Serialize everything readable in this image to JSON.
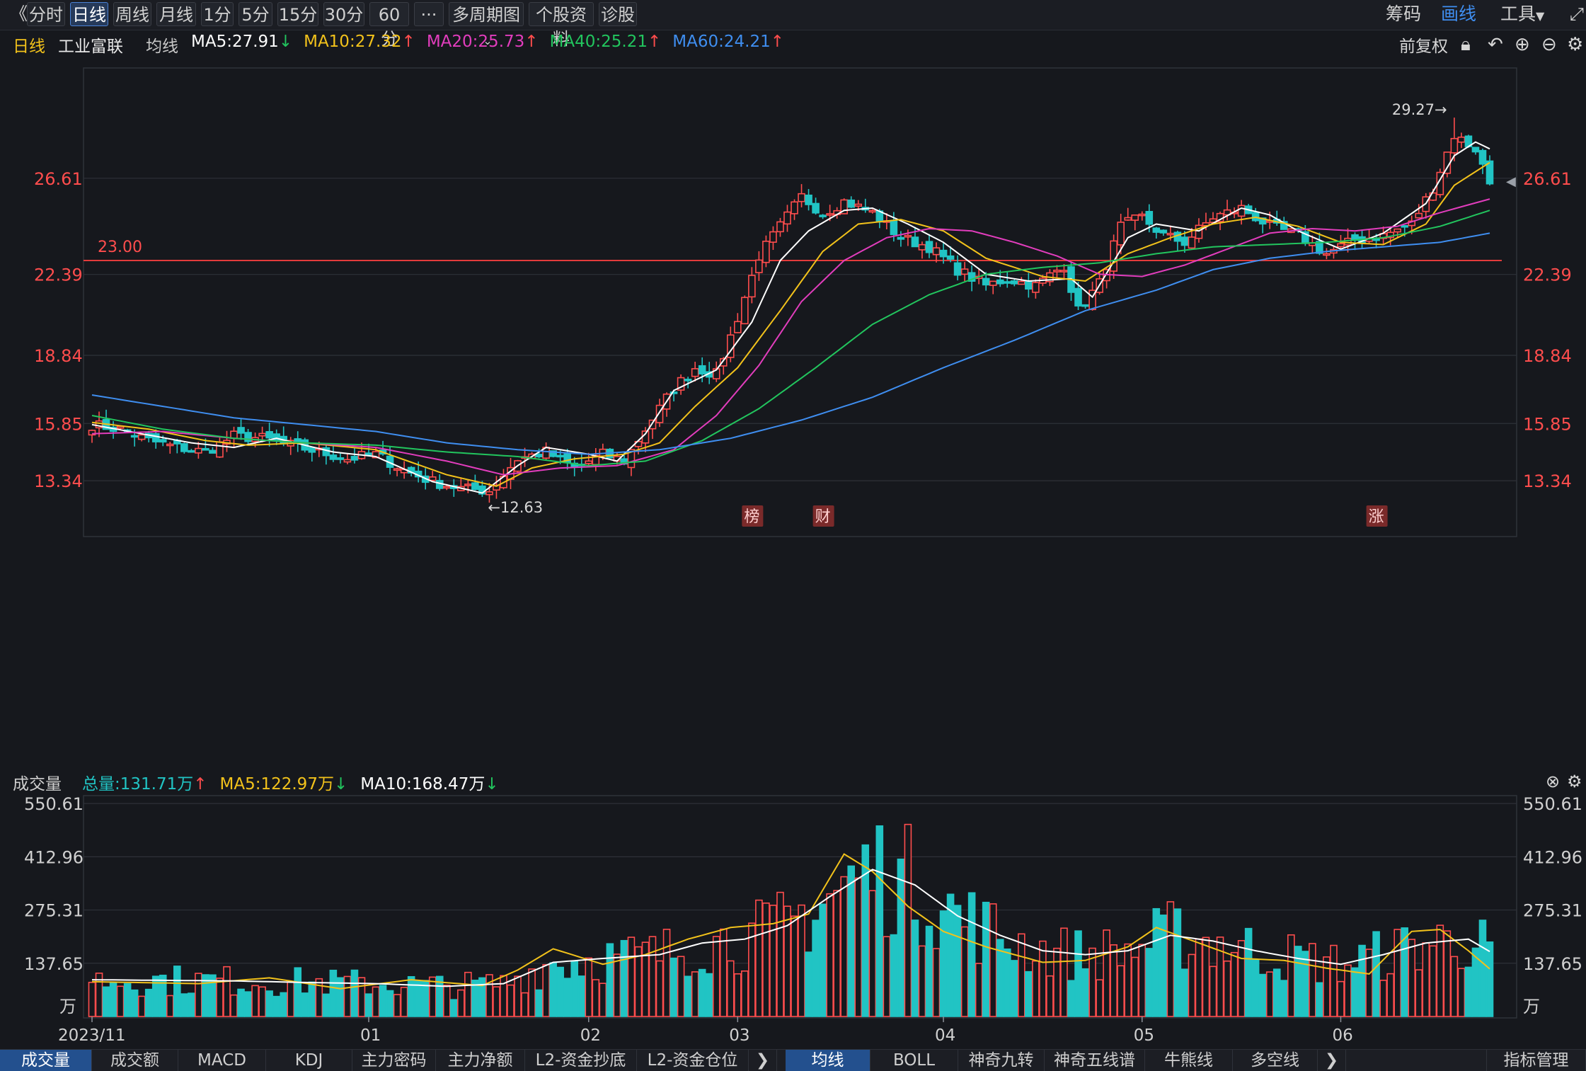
{
  "toolbar": {
    "back_glyph": "《",
    "periods": [
      "分时",
      "日线",
      "周线",
      "月线",
      "1分",
      "5分",
      "15分",
      "30分",
      "60分"
    ],
    "active_period": "日线",
    "more_glyph": "···",
    "multi_period": "多周期图",
    "stock_info": "个股资料",
    "diagnose": "诊股",
    "right": {
      "chips": "筹码",
      "draw": "画线",
      "tools": "工具"
    }
  },
  "ma_header": {
    "period": "日线",
    "stock_name": "工业富联",
    "mode": "均线",
    "items": [
      {
        "label": "MA5:27.91",
        "arrow": "↓",
        "color": "#ffffff",
        "arrow_color": "#22c55e"
      },
      {
        "label": "MA10:27.32",
        "arrow": "↑",
        "color": "#f2c21b",
        "arrow_color": "#ff4d4d"
      },
      {
        "label": "MA20:25.73",
        "arrow": "↑",
        "color": "#e23dbd",
        "arrow_color": "#ff4d4d"
      },
      {
        "label": "MA40:25.21",
        "arrow": "↑",
        "color": "#22c55e",
        "arrow_color": "#ff4d4d"
      },
      {
        "label": "MA60:24.21",
        "arrow": "↑",
        "color": "#3f8ef0",
        "arrow_color": "#ff4d4d"
      }
    ],
    "adjust": "前复权"
  },
  "vol_header": {
    "title": "成交量",
    "items": [
      {
        "label": "总量:131.71万",
        "arrow": "↑",
        "color": "#21c4c4",
        "arrow_color": "#ff4d4d"
      },
      {
        "label": "MA5:122.97万",
        "arrow": "↓",
        "color": "#f2c21b",
        "arrow_color": "#22c55e"
      },
      {
        "label": "MA10:168.47万",
        "arrow": "↓",
        "color": "#ffffff",
        "arrow_color": "#22c55e"
      }
    ]
  },
  "colors": {
    "up": "#ff4d4d",
    "down": "#21c4c4",
    "ma5": "#ffffff",
    "ma10": "#f2c21b",
    "ma20": "#e23dbd",
    "ma40": "#22c55e",
    "ma60": "#3f8ef0",
    "hline": "#e23b3b"
  },
  "chart_data": {
    "type": "candlestick",
    "price_axis": {
      "ticks": [
        "26.61",
        "22.39",
        "18.84",
        "15.85",
        "13.34"
      ],
      "ylim": [
        11.2,
        31.2
      ]
    },
    "volume_axis": {
      "ticks": [
        "550.61",
        "412.96",
        "275.31",
        "137.65"
      ],
      "unit": "万",
      "ylim": [
        0,
        560
      ]
    },
    "x_labels": [
      {
        "label": "2023/11",
        "index": 0
      },
      {
        "label": "01",
        "index": 39
      },
      {
        "label": "02",
        "index": 70
      },
      {
        "label": "03",
        "index": 91
      },
      {
        "label": "04",
        "index": 120
      },
      {
        "label": "05",
        "index": 148
      },
      {
        "label": "06",
        "index": 176
      }
    ],
    "price_line": {
      "value": 23.0,
      "label": "23.00"
    },
    "max_label": {
      "text": "29.27→",
      "index": 192,
      "value": 29.27
    },
    "min_label": {
      "text": "←12.63",
      "index": 55,
      "value": 12.63
    },
    "last_marker": "26.61",
    "badges": [
      {
        "text": "榜",
        "index": 93
      },
      {
        "text": "财",
        "index": 103
      },
      {
        "text": "涨",
        "index": 181
      }
    ],
    "anchors": [
      [
        0,
        15.8
      ],
      [
        4,
        15.6
      ],
      [
        8,
        15.1
      ],
      [
        12,
        14.8
      ],
      [
        16,
        14.6
      ],
      [
        20,
        15.3
      ],
      [
        24,
        15.2
      ],
      [
        28,
        14.9
      ],
      [
        32,
        14.6
      ],
      [
        36,
        14.3
      ],
      [
        40,
        14.5
      ],
      [
        44,
        13.8
      ],
      [
        48,
        13.3
      ],
      [
        52,
        13.0
      ],
      [
        56,
        12.9
      ],
      [
        60,
        14.3
      ],
      [
        64,
        14.6
      ],
      [
        68,
        13.9
      ],
      [
        72,
        14.5
      ],
      [
        75,
        14.2
      ],
      [
        78,
        15.6
      ],
      [
        82,
        17.4
      ],
      [
        85,
        18.3
      ],
      [
        88,
        18.0
      ],
      [
        91,
        20.5
      ],
      [
        94,
        23.2
      ],
      [
        97,
        24.5
      ],
      [
        100,
        25.8
      ],
      [
        103,
        25.1
      ],
      [
        106,
        25.6
      ],
      [
        110,
        25.1
      ],
      [
        114,
        24.0
      ],
      [
        118,
        23.6
      ],
      [
        122,
        22.6
      ],
      [
        126,
        21.9
      ],
      [
        129,
        22.2
      ],
      [
        133,
        21.9
      ],
      [
        137,
        22.8
      ],
      [
        139,
        20.8
      ],
      [
        142,
        22.0
      ],
      [
        145,
        24.5
      ],
      [
        148,
        24.9
      ],
      [
        151,
        24.1
      ],
      [
        154,
        23.8
      ],
      [
        158,
        24.9
      ],
      [
        162,
        25.3
      ],
      [
        166,
        24.5
      ],
      [
        170,
        24.1
      ],
      [
        174,
        23.3
      ],
      [
        178,
        23.9
      ],
      [
        182,
        24.1
      ],
      [
        186,
        24.6
      ],
      [
        189,
        26.2
      ],
      [
        192,
        28.5
      ],
      [
        195,
        27.9
      ],
      [
        197,
        26.4
      ]
    ],
    "series": [
      {
        "name": "MA5",
        "values": [
          [
            0,
            15.8
          ],
          [
            14,
            15.0
          ],
          [
            20,
            14.8
          ],
          [
            26,
            15.2
          ],
          [
            34,
            14.6
          ],
          [
            40,
            14.4
          ],
          [
            48,
            13.3
          ],
          [
            55,
            12.8
          ],
          [
            60,
            14.0
          ],
          [
            64,
            14.8
          ],
          [
            70,
            14.5
          ],
          [
            74,
            14.2
          ],
          [
            78,
            15.4
          ],
          [
            82,
            17.3
          ],
          [
            88,
            18.2
          ],
          [
            93,
            20.3
          ],
          [
            97,
            23.0
          ],
          [
            101,
            24.3
          ],
          [
            106,
            25.2
          ],
          [
            110,
            25.3
          ],
          [
            115,
            24.6
          ],
          [
            120,
            23.8
          ],
          [
            126,
            22.4
          ],
          [
            132,
            22.1
          ],
          [
            138,
            22.2
          ],
          [
            141,
            21.4
          ],
          [
            146,
            24.0
          ],
          [
            150,
            24.6
          ],
          [
            156,
            24.3
          ],
          [
            162,
            25.3
          ],
          [
            166,
            25.0
          ],
          [
            170,
            24.3
          ],
          [
            176,
            23.5
          ],
          [
            182,
            24.2
          ],
          [
            188,
            25.5
          ],
          [
            192,
            27.6
          ],
          [
            195,
            28.2
          ],
          [
            197,
            27.9
          ]
        ]
      },
      {
        "name": "MA10",
        "values": [
          [
            0,
            15.9
          ],
          [
            8,
            15.6
          ],
          [
            16,
            15.1
          ],
          [
            22,
            14.9
          ],
          [
            30,
            15.0
          ],
          [
            40,
            14.7
          ],
          [
            50,
            13.6
          ],
          [
            57,
            13.1
          ],
          [
            62,
            13.9
          ],
          [
            68,
            14.3
          ],
          [
            75,
            14.5
          ],
          [
            80,
            15.0
          ],
          [
            85,
            16.6
          ],
          [
            91,
            18.3
          ],
          [
            97,
            20.8
          ],
          [
            103,
            23.4
          ],
          [
            108,
            24.6
          ],
          [
            114,
            24.8
          ],
          [
            120,
            24.3
          ],
          [
            126,
            23.1
          ],
          [
            134,
            22.3
          ],
          [
            140,
            22.1
          ],
          [
            146,
            23.3
          ],
          [
            152,
            24.0
          ],
          [
            158,
            24.6
          ],
          [
            164,
            24.9
          ],
          [
            170,
            24.5
          ],
          [
            176,
            23.8
          ],
          [
            182,
            23.7
          ],
          [
            188,
            24.6
          ],
          [
            192,
            26.3
          ],
          [
            197,
            27.3
          ]
        ]
      },
      {
        "name": "MA20",
        "values": [
          [
            0,
            15.4
          ],
          [
            10,
            15.5
          ],
          [
            20,
            15.2
          ],
          [
            30,
            15.0
          ],
          [
            40,
            14.8
          ],
          [
            50,
            14.2
          ],
          [
            58,
            13.6
          ],
          [
            66,
            13.9
          ],
          [
            74,
            14.0
          ],
          [
            82,
            14.7
          ],
          [
            88,
            16.2
          ],
          [
            94,
            18.4
          ],
          [
            100,
            21.2
          ],
          [
            106,
            23.0
          ],
          [
            112,
            24.0
          ],
          [
            118,
            24.4
          ],
          [
            124,
            24.3
          ],
          [
            130,
            23.8
          ],
          [
            136,
            23.2
          ],
          [
            142,
            22.4
          ],
          [
            148,
            22.3
          ],
          [
            154,
            22.8
          ],
          [
            160,
            23.5
          ],
          [
            166,
            24.2
          ],
          [
            172,
            24.4
          ],
          [
            178,
            24.3
          ],
          [
            184,
            24.5
          ],
          [
            190,
            25.1
          ],
          [
            197,
            25.7
          ]
        ]
      },
      {
        "name": "MA40",
        "values": [
          [
            0,
            16.2
          ],
          [
            10,
            15.6
          ],
          [
            20,
            15.2
          ],
          [
            30,
            15.0
          ],
          [
            40,
            14.9
          ],
          [
            50,
            14.6
          ],
          [
            60,
            14.4
          ],
          [
            70,
            14.0
          ],
          [
            78,
            14.2
          ],
          [
            86,
            15.1
          ],
          [
            94,
            16.5
          ],
          [
            102,
            18.3
          ],
          [
            110,
            20.2
          ],
          [
            118,
            21.5
          ],
          [
            126,
            22.4
          ],
          [
            134,
            22.7
          ],
          [
            142,
            22.9
          ],
          [
            150,
            23.3
          ],
          [
            158,
            23.6
          ],
          [
            166,
            23.7
          ],
          [
            174,
            23.8
          ],
          [
            182,
            24.0
          ],
          [
            190,
            24.5
          ],
          [
            197,
            25.2
          ]
        ]
      },
      {
        "name": "MA60",
        "values": [
          [
            0,
            17.1
          ],
          [
            10,
            16.6
          ],
          [
            20,
            16.1
          ],
          [
            30,
            15.8
          ],
          [
            40,
            15.5
          ],
          [
            50,
            15.0
          ],
          [
            60,
            14.7
          ],
          [
            70,
            14.5
          ],
          [
            80,
            14.7
          ],
          [
            90,
            15.2
          ],
          [
            100,
            16.0
          ],
          [
            110,
            17.0
          ],
          [
            120,
            18.3
          ],
          [
            130,
            19.5
          ],
          [
            140,
            20.8
          ],
          [
            150,
            21.7
          ],
          [
            158,
            22.6
          ],
          [
            166,
            23.1
          ],
          [
            174,
            23.4
          ],
          [
            182,
            23.6
          ],
          [
            190,
            23.8
          ],
          [
            197,
            24.2
          ]
        ]
      }
    ],
    "volume_series": [
      {
        "name": "MA5",
        "anchors": [
          [
            0,
            90
          ],
          [
            15,
            85
          ],
          [
            25,
            100
          ],
          [
            35,
            72
          ],
          [
            45,
            95
          ],
          [
            55,
            80
          ],
          [
            60,
            120
          ],
          [
            65,
            175
          ],
          [
            72,
            135
          ],
          [
            78,
            160
          ],
          [
            84,
            200
          ],
          [
            90,
            230
          ],
          [
            96,
            240
          ],
          [
            101,
            265
          ],
          [
            106,
            420
          ],
          [
            110,
            375
          ],
          [
            115,
            285
          ],
          [
            120,
            220
          ],
          [
            126,
            180
          ],
          [
            134,
            140
          ],
          [
            140,
            145
          ],
          [
            146,
            180
          ],
          [
            150,
            230
          ],
          [
            156,
            190
          ],
          [
            162,
            150
          ],
          [
            168,
            145
          ],
          [
            174,
            125
          ],
          [
            180,
            110
          ],
          [
            186,
            220
          ],
          [
            190,
            225
          ],
          [
            194,
            170
          ],
          [
            197,
            123
          ]
        ]
      },
      {
        "name": "MA10",
        "anchors": [
          [
            0,
            95
          ],
          [
            20,
            92
          ],
          [
            30,
            88
          ],
          [
            40,
            85
          ],
          [
            50,
            78
          ],
          [
            58,
            85
          ],
          [
            65,
            140
          ],
          [
            72,
            150
          ],
          [
            80,
            160
          ],
          [
            86,
            190
          ],
          [
            92,
            200
          ],
          [
            98,
            235
          ],
          [
            104,
            310
          ],
          [
            110,
            380
          ],
          [
            116,
            340
          ],
          [
            122,
            260
          ],
          [
            128,
            210
          ],
          [
            134,
            170
          ],
          [
            140,
            160
          ],
          [
            146,
            170
          ],
          [
            152,
            210
          ],
          [
            158,
            195
          ],
          [
            164,
            170
          ],
          [
            170,
            150
          ],
          [
            176,
            135
          ],
          [
            182,
            160
          ],
          [
            188,
            190
          ],
          [
            194,
            200
          ],
          [
            197,
            168
          ]
        ]
      }
    ]
  },
  "bottom_tabs": {
    "left": [
      "成交量",
      "成交额",
      "MACD",
      "KDJ",
      "主力密码",
      "主力净额",
      "L2-资金抄底",
      "L2-资金仓位"
    ],
    "right": [
      "均线",
      "BOLL",
      "神奇九转",
      "神奇五线谱",
      "牛熊线",
      "多空线"
    ],
    "manage": "指标管理",
    "arrow": "❯"
  }
}
